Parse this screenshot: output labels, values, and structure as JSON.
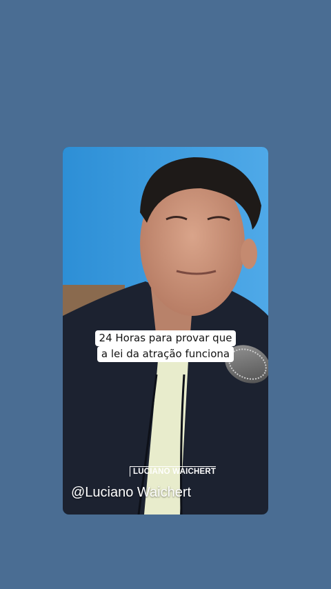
{
  "page": {
    "background_color": "#4a6d93"
  },
  "video": {
    "caption_lines": [
      "24 Horas para provar que",
      "a lei da atração funciona"
    ],
    "brand_logo_text": "LUCIANO WAICHERT",
    "handle": "@Luciano Waichert"
  }
}
